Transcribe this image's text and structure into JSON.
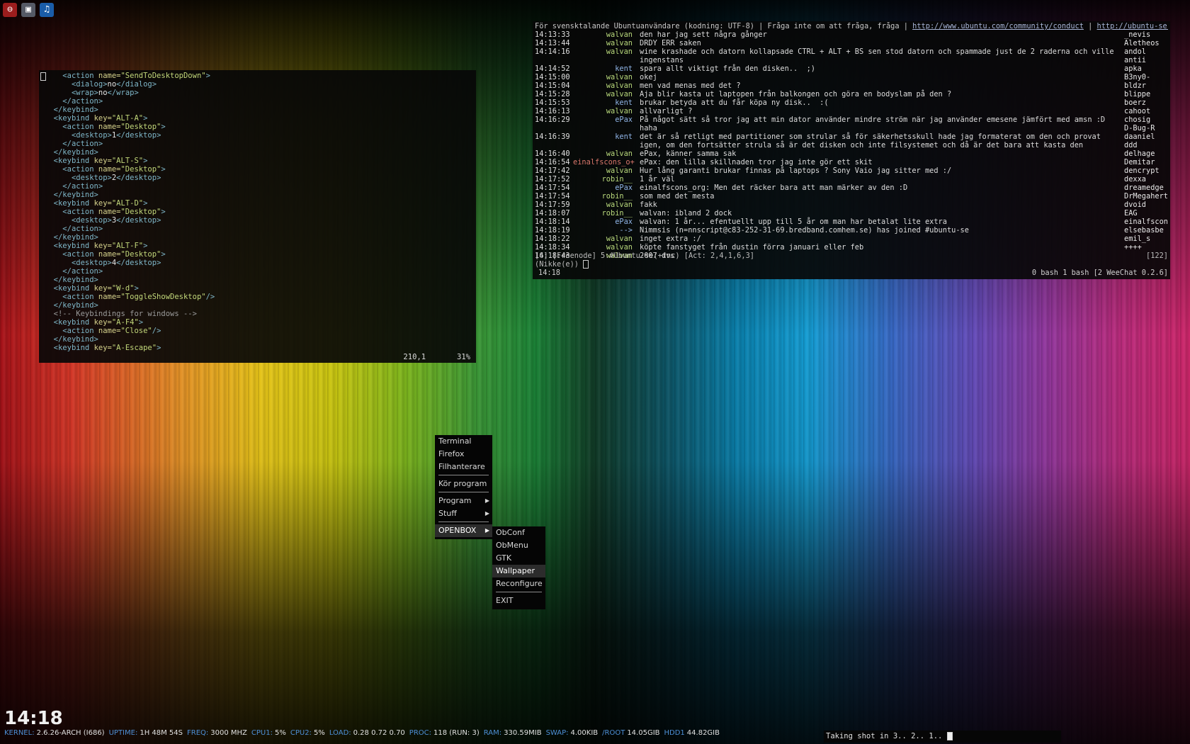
{
  "vim": {
    "lines": [
      [
        {
          "c": "",
          "t": "    "
        },
        {
          "c": "tag",
          "t": "<action "
        },
        {
          "c": "attr",
          "t": "name="
        },
        {
          "c": "str",
          "t": "\"SendToDesktopDown\""
        },
        {
          "c": "tag",
          "t": ">"
        }
      ],
      [
        {
          "c": "",
          "t": "      "
        },
        {
          "c": "tag",
          "t": "<dialog>"
        },
        {
          "c": "txt",
          "t": "no"
        },
        {
          "c": "tag",
          "t": "</dialog>"
        }
      ],
      [
        {
          "c": "",
          "t": "      "
        },
        {
          "c": "tag",
          "t": "<wrap>"
        },
        {
          "c": "txt",
          "t": "no"
        },
        {
          "c": "tag",
          "t": "</wrap>"
        }
      ],
      [
        {
          "c": "",
          "t": "    "
        },
        {
          "c": "tag",
          "t": "</action>"
        }
      ],
      [
        {
          "c": "",
          "t": "  "
        },
        {
          "c": "tag",
          "t": "</keybind>"
        }
      ],
      [
        {
          "c": "",
          "t": "  "
        },
        {
          "c": "tag",
          "t": "<keybind "
        },
        {
          "c": "attr",
          "t": "key="
        },
        {
          "c": "str",
          "t": "\"ALT-A\""
        },
        {
          "c": "tag",
          "t": ">"
        }
      ],
      [
        {
          "c": "",
          "t": "    "
        },
        {
          "c": "tag",
          "t": "<action "
        },
        {
          "c": "attr",
          "t": "name="
        },
        {
          "c": "str",
          "t": "\"Desktop\""
        },
        {
          "c": "tag",
          "t": ">"
        }
      ],
      [
        {
          "c": "",
          "t": "      "
        },
        {
          "c": "tag",
          "t": "<desktop>"
        },
        {
          "c": "txt",
          "t": "1"
        },
        {
          "c": "tag",
          "t": "</desktop>"
        }
      ],
      [
        {
          "c": "",
          "t": "    "
        },
        {
          "c": "tag",
          "t": "</action>"
        }
      ],
      [
        {
          "c": "",
          "t": "  "
        },
        {
          "c": "tag",
          "t": "</keybind>"
        }
      ],
      [
        {
          "c": "",
          "t": "  "
        },
        {
          "c": "tag",
          "t": "<keybind "
        },
        {
          "c": "attr",
          "t": "key="
        },
        {
          "c": "str",
          "t": "\"ALT-S\""
        },
        {
          "c": "tag",
          "t": ">"
        }
      ],
      [
        {
          "c": "",
          "t": "    "
        },
        {
          "c": "tag",
          "t": "<action "
        },
        {
          "c": "attr",
          "t": "name="
        },
        {
          "c": "str",
          "t": "\"Desktop\""
        },
        {
          "c": "tag",
          "t": ">"
        }
      ],
      [
        {
          "c": "",
          "t": "      "
        },
        {
          "c": "tag",
          "t": "<desktop>"
        },
        {
          "c": "txt",
          "t": "2"
        },
        {
          "c": "tag",
          "t": "</desktop>"
        }
      ],
      [
        {
          "c": "",
          "t": "    "
        },
        {
          "c": "tag",
          "t": "</action>"
        }
      ],
      [
        {
          "c": "",
          "t": "  "
        },
        {
          "c": "tag",
          "t": "</keybind>"
        }
      ],
      [
        {
          "c": "",
          "t": "  "
        },
        {
          "c": "tag",
          "t": "<keybind "
        },
        {
          "c": "attr",
          "t": "key="
        },
        {
          "c": "str",
          "t": "\"ALT-D\""
        },
        {
          "c": "tag",
          "t": ">"
        }
      ],
      [
        {
          "c": "",
          "t": "    "
        },
        {
          "c": "tag",
          "t": "<action "
        },
        {
          "c": "attr",
          "t": "name="
        },
        {
          "c": "str",
          "t": "\"Desktop\""
        },
        {
          "c": "tag",
          "t": ">"
        }
      ],
      [
        {
          "c": "",
          "t": "      "
        },
        {
          "c": "tag",
          "t": "<desktop>"
        },
        {
          "c": "txt",
          "t": "3"
        },
        {
          "c": "tag",
          "t": "</desktop>"
        }
      ],
      [
        {
          "c": "",
          "t": "    "
        },
        {
          "c": "tag",
          "t": "</action>"
        }
      ],
      [
        {
          "c": "",
          "t": "  "
        },
        {
          "c": "tag",
          "t": "</keybind>"
        }
      ],
      [
        {
          "c": "",
          "t": "  "
        },
        {
          "c": "tag",
          "t": "<keybind "
        },
        {
          "c": "attr",
          "t": "key="
        },
        {
          "c": "str",
          "t": "\"ALT-F\""
        },
        {
          "c": "tag",
          "t": ">"
        }
      ],
      [
        {
          "c": "",
          "t": "    "
        },
        {
          "c": "tag",
          "t": "<action "
        },
        {
          "c": "attr",
          "t": "name="
        },
        {
          "c": "str",
          "t": "\"Desktop\""
        },
        {
          "c": "tag",
          "t": ">"
        }
      ],
      [
        {
          "c": "",
          "t": "      "
        },
        {
          "c": "tag",
          "t": "<desktop>"
        },
        {
          "c": "txt",
          "t": "4"
        },
        {
          "c": "tag",
          "t": "</desktop>"
        }
      ],
      [
        {
          "c": "",
          "t": "    "
        },
        {
          "c": "tag",
          "t": "</action>"
        }
      ],
      [
        {
          "c": "",
          "t": "  "
        },
        {
          "c": "tag",
          "t": "</keybind>"
        }
      ],
      [
        {
          "c": "",
          "t": "  "
        },
        {
          "c": "tag",
          "t": "<keybind "
        },
        {
          "c": "attr",
          "t": "key="
        },
        {
          "c": "str",
          "t": "\"W-d\""
        },
        {
          "c": "tag",
          "t": ">"
        }
      ],
      [
        {
          "c": "",
          "t": "    "
        },
        {
          "c": "tag",
          "t": "<action "
        },
        {
          "c": "attr",
          "t": "name="
        },
        {
          "c": "str",
          "t": "\"ToggleShowDesktop\""
        },
        {
          "c": "tag",
          "t": "/>"
        }
      ],
      [
        {
          "c": "",
          "t": "  "
        },
        {
          "c": "tag",
          "t": "</keybind>"
        }
      ],
      [
        {
          "c": "",
          "t": "  "
        },
        {
          "c": "cmt",
          "t": "<!-- Keybindings for windows -->"
        }
      ],
      [
        {
          "c": "",
          "t": "  "
        },
        {
          "c": "tag",
          "t": "<keybind "
        },
        {
          "c": "attr",
          "t": "key="
        },
        {
          "c": "str",
          "t": "\"A-F4\""
        },
        {
          "c": "tag",
          "t": ">"
        }
      ],
      [
        {
          "c": "",
          "t": "    "
        },
        {
          "c": "tag",
          "t": "<action "
        },
        {
          "c": "attr",
          "t": "name="
        },
        {
          "c": "str",
          "t": "\"Close\""
        },
        {
          "c": "tag",
          "t": "/>"
        }
      ],
      [
        {
          "c": "",
          "t": "  "
        },
        {
          "c": "tag",
          "t": "</keybind>"
        }
      ],
      [
        {
          "c": "",
          "t": "  "
        },
        {
          "c": "tag",
          "t": "<keybind "
        },
        {
          "c": "attr",
          "t": "key="
        },
        {
          "c": "str",
          "t": "\"A-Escape\""
        },
        {
          "c": "tag",
          "t": ">"
        }
      ]
    ],
    "position": "210,1",
    "percent": "31%"
  },
  "weechat": {
    "topic_text": "För svensktalande Ubuntuanvändare (kodning: UTF-8) | Fråga inte om att fråga, fråga | ",
    "topic_url1": "http://www.ubuntu.com/community/conduct",
    "topic_sep": " | ",
    "topic_url2": "http://ubuntu-se.or",
    "topic_more": "++",
    "messages": [
      {
        "time": "14:13:33",
        "nick": "walvan",
        "nick_color": "#b9d97c",
        "text": "den har jag sett några gånger"
      },
      {
        "time": "14:13:44",
        "nick": "walvan",
        "nick_color": "#b9d97c",
        "text": "DRDY ERR saken"
      },
      {
        "time": "14:14:16",
        "nick": "walvan",
        "nick_color": "#b9d97c",
        "text": "wine krashade och datorn kollapsade CTRL + ALT + BS sen stod datorn och spammade just de 2 raderna och ville ingenstans"
      },
      {
        "time": "14:14:52",
        "nick": "kent",
        "nick_color": "#8fb4e6",
        "text": "spara allt viktigt från den disken..  ;)"
      },
      {
        "time": "14:15:00",
        "nick": "walvan",
        "nick_color": "#b9d97c",
        "text": "okej"
      },
      {
        "time": "14:15:04",
        "nick": "walvan",
        "nick_color": "#b9d97c",
        "text": "men vad menas med det ?"
      },
      {
        "time": "14:15:28",
        "nick": "walvan",
        "nick_color": "#b9d97c",
        "text": "Aja blir kasta ut laptopen från balkongen och göra en bodyslam på den ?"
      },
      {
        "time": "14:15:53",
        "nick": "kent",
        "nick_color": "#8fb4e6",
        "text": "brukar betyda att du får köpa ny disk..  :("
      },
      {
        "time": "14:16:13",
        "nick": "walvan",
        "nick_color": "#b9d97c",
        "text": "allvarligt ?"
      },
      {
        "time": "14:16:29",
        "nick": "ePax",
        "nick_color": "#8fb4e6",
        "text": "På något sätt så tror jag att min dator använder mindre ström när jag använder emesene jämfört med amsn :D haha"
      },
      {
        "time": "14:16:39",
        "nick": "kent",
        "nick_color": "#8fb4e6",
        "text": "det är så retligt med partitioner som strular så för säkerhetsskull hade jag formaterat om den och provat igen, om den fortsätter strula så är det disken och inte filsystemet och då är det bara att kasta den"
      },
      {
        "time": "14:16:40",
        "nick": "walvan",
        "nick_color": "#b9d97c",
        "text": "ePax, känner samma sak"
      },
      {
        "time": "14:16:54",
        "nick": "einalfscons_o+",
        "nick_color": "#d9766b",
        "text": "ePax: den lilla skillnaden tror jag inte gör ett skit"
      },
      {
        "time": "14:17:42",
        "nick": "walvan",
        "nick_color": "#b9d97c",
        "text": "Hur lång garanti brukar finnas på laptops ? Sony Vaio jag sitter med :/"
      },
      {
        "time": "14:17:52",
        "nick": "robin__",
        "nick_color": "#b9d97c",
        "text": "1 år väl"
      },
      {
        "time": "14:17:54",
        "nick": "ePax",
        "nick_color": "#8fb4e6",
        "text": "einalfscons_org: Men det räcker bara att man märker av den :D"
      },
      {
        "time": "14:17:54",
        "nick": "robin__",
        "nick_color": "#b9d97c",
        "text": "som med det mesta"
      },
      {
        "time": "14:17:59",
        "nick": "walvan",
        "nick_color": "#b9d97c",
        "text": "fakk"
      },
      {
        "time": "14:18:07",
        "nick": "robin__",
        "nick_color": "#b9d97c",
        "text": "walvan: ibland 2 dock"
      },
      {
        "time": "14:18:14",
        "nick": "ePax",
        "nick_color": "#8fb4e6",
        "text": "walvan: 1 år... efentuellt upp till 5 år om man har betalat lite extra"
      },
      {
        "time": "14:18:19",
        "nick": "-->",
        "nick_color": "#8fb4e6",
        "text": "Nimmsis (n=nnscript@c83-252-31-69.bredband.comhem.se) has joined #ubuntu-se"
      },
      {
        "time": "14:18:22",
        "nick": "walvan",
        "nick_color": "#b9d97c",
        "text": "inget extra :/"
      },
      {
        "time": "14:18:34",
        "nick": "walvan",
        "nick_color": "#b9d97c",
        "text": "köpte fanstyget från dustin förra januari eller feb"
      },
      {
        "time": "14:18:43",
        "nick": "walvan",
        "nick_color": "#b9d97c",
        "text": "2007 dvs"
      }
    ],
    "nicks": [
      "_nevis",
      "Aletheos",
      "andol",
      "antii",
      "apka",
      "B3ny0-",
      "bldzr",
      "blippe",
      "boerz",
      "cahoot",
      "chosig",
      "D-Bug-R",
      "daaniel",
      "ddd",
      "delhage",
      "Demitar",
      "dencrypt",
      "dexxa",
      "dreamedge",
      "DrMegahert",
      "dvoid",
      "EAG",
      "einalfscon",
      "elsebasbe",
      "emil_s",
      "++++"
    ],
    "status_line": "[6] [Freenode] 5:#Ubuntu-se(+tnc) [Act: 2,4,1,6,3]",
    "status_count": "[122]",
    "input_prompt": "(Nikke(e))",
    "bottom_time": "14:18",
    "bottom_right": "0 bash  1 bash  [2 WeeChat 0.2.6]"
  },
  "menu": {
    "root": {
      "terminal": "Terminal",
      "firefox": "Firefox",
      "files": "Filhanterare",
      "run": "Kör program",
      "programs": "Program",
      "stuff": "Stuff",
      "openbox": "OPENBOX"
    },
    "openbox": {
      "obconf": "ObConf",
      "obmenu": "ObMenu",
      "gtk": "GTK",
      "wallpaper": "Wallpaper",
      "reconfigure": "Reconfigure",
      "exit": "EXIT"
    }
  },
  "clock": "14:18",
  "conky": [
    {
      "label": "KERNEL:",
      "value": "2.6.26-ARCH (I686)"
    },
    {
      "label": "UPTIME:",
      "value": "1H 48M 54S"
    },
    {
      "label": "FREQ:",
      "value": "3000 MHZ"
    },
    {
      "label": "CPU1:",
      "value": "5%"
    },
    {
      "label": "CPU2:",
      "value": "5%"
    },
    {
      "label": "LOAD:",
      "value": "0.28 0.72 0.70"
    },
    {
      "label": "PROC:",
      "value": "118 (RUN: 3)"
    },
    {
      "label": "RAM:",
      "value": "330.59MIB"
    },
    {
      "label": "SWAP:",
      "value": "4.00KIB"
    },
    {
      "label": "/ROOT",
      "value": "14.05GIB"
    },
    {
      "label": "HDD1",
      "value": "44.82GIB"
    }
  ],
  "shot_message": "Taking shot in 3.. 2.. 1.."
}
